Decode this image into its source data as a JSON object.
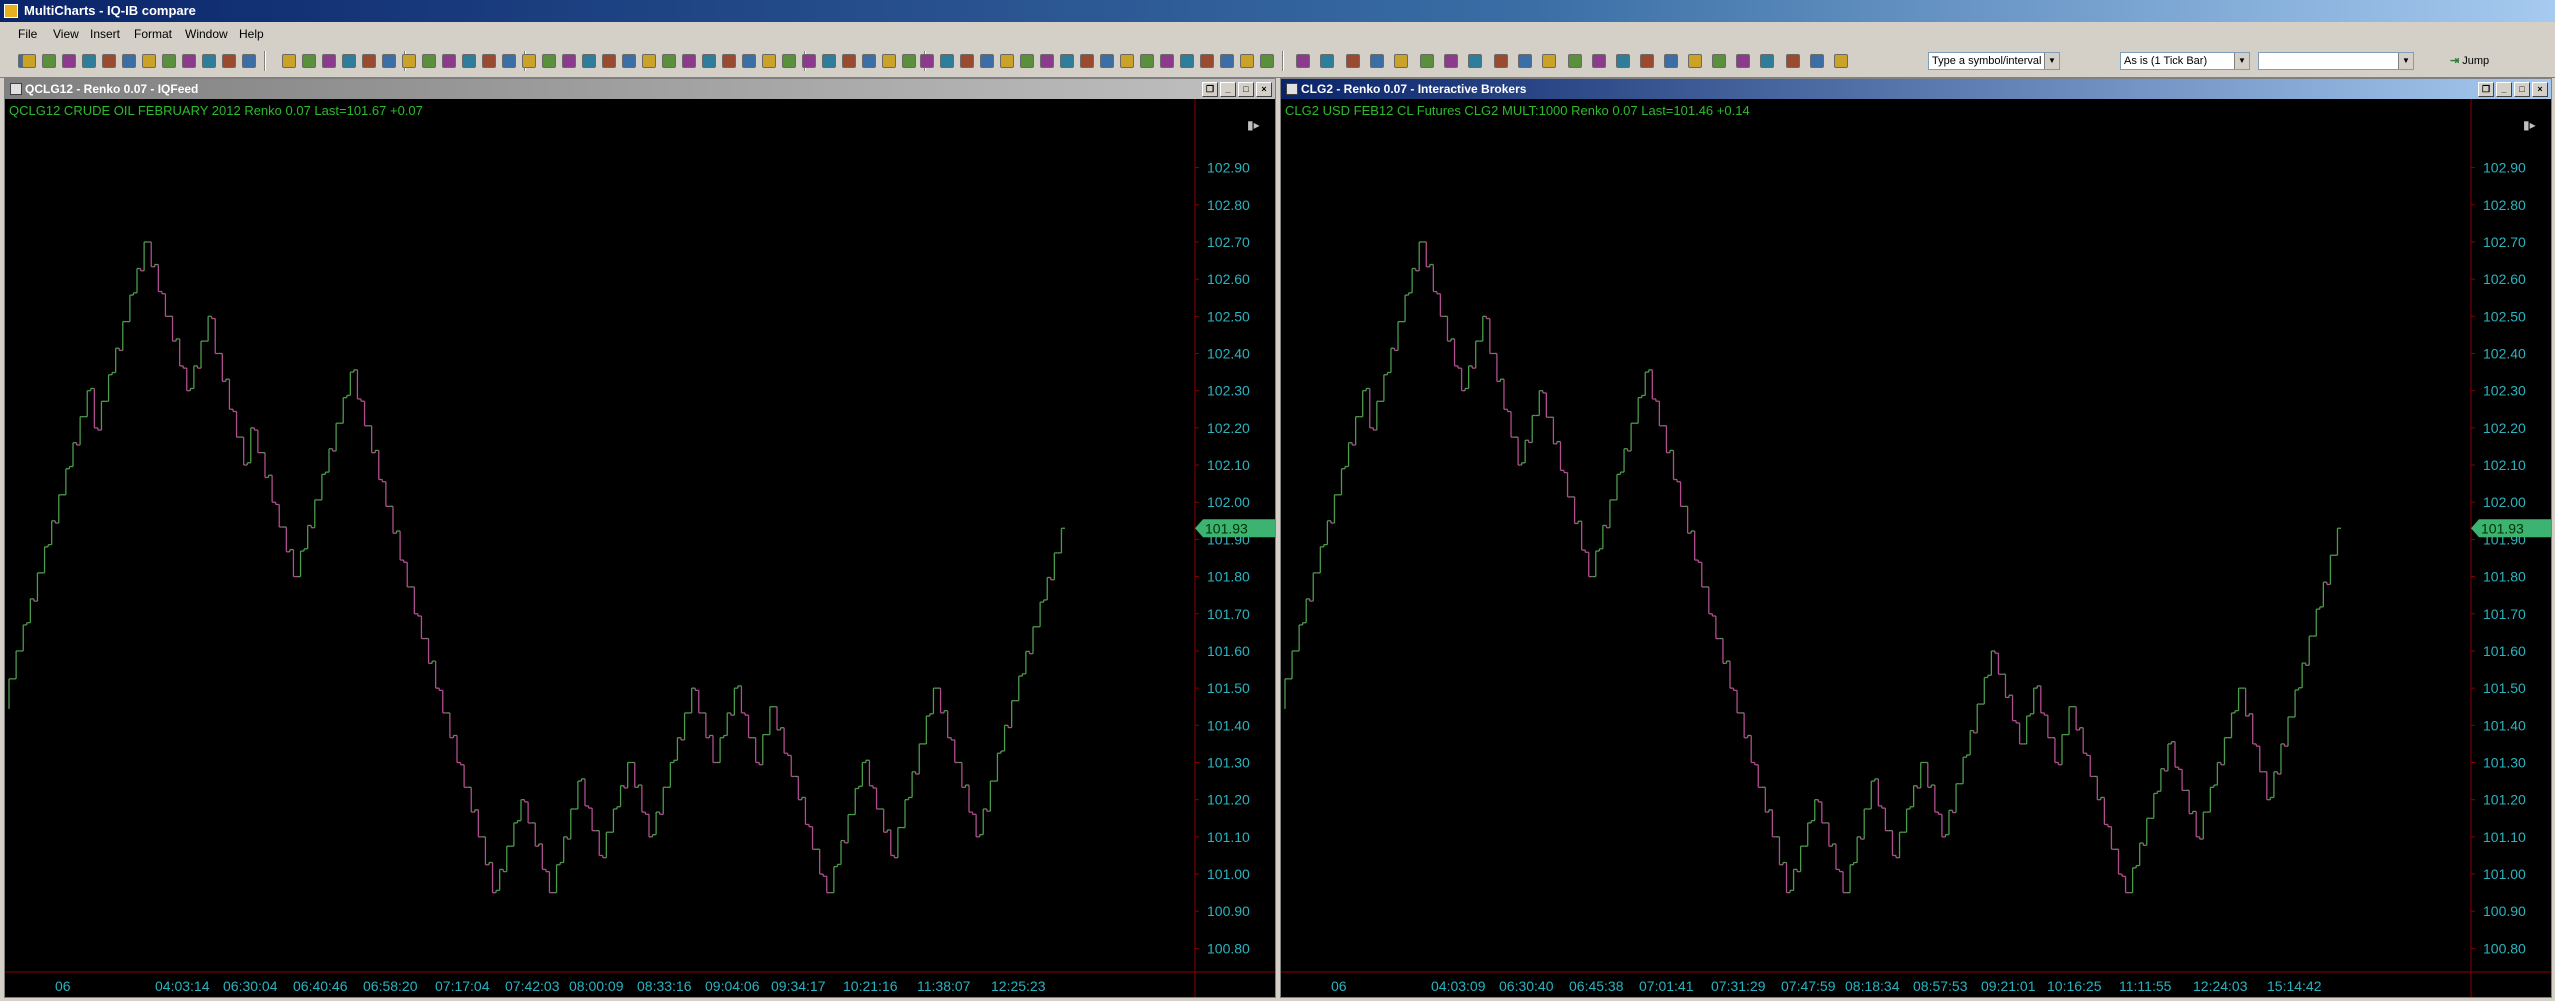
{
  "app": {
    "title": "MultiCharts - IQ-IB compare"
  },
  "menu": [
    "File",
    "View",
    "Insert",
    "Format",
    "Window",
    "Help"
  ],
  "toolbar": {
    "symbol_select": "Type a symbol/interval",
    "interval_select": "As is (1 Tick Bar)",
    "extra_select": "",
    "jump_label": "Jump"
  },
  "colors": {
    "up": "#4c9a4c",
    "down": "#b04e8e",
    "axis_text": "#2bb3c0",
    "info_text": "#2dbb2d",
    "axis_line": "#8b0000",
    "price_badge": "#3cb371"
  },
  "charts": [
    {
      "window_title": "QCLG12 - Renko 0.07 - IQFeed",
      "status": {
        "symbol": "QCLG12",
        "description": "CRUDE OIL FEBRUARY 2012",
        "renko": "Renko 0.07",
        "last": "Last=101.67",
        "change": "+0.07"
      },
      "time_labels": [
        "06",
        "04:03:14",
        "06:30:04",
        "06:40:46",
        "06:58:20",
        "07:17:04",
        "07:42:03",
        "08:00:09",
        "08:33:16",
        "09:04:06",
        "09:34:17",
        "10:21:16",
        "11:38:07",
        "12:25:23"
      ],
      "price_badge": "101.93"
    },
    {
      "window_title": "CLG2 - Renko 0.07 - Interactive Brokers",
      "status": {
        "symbol": "CLG2",
        "description": "USD FEB12 CL Futures CLG2 MULT:1000",
        "renko": "Renko 0.07",
        "last": "Last=101.46",
        "change": "+0.14"
      },
      "time_labels": [
        "06",
        "04:03:09",
        "06:30:40",
        "06:45:38",
        "07:01:41",
        "07:31:29",
        "07:47:59",
        "08:18:34",
        "08:57:53",
        "09:21:01",
        "10:16:25",
        "11:11:55",
        "12:24:03",
        "15:14:42"
      ],
      "price_badge": "101.93"
    }
  ],
  "chart_data": [
    {
      "type": "renko",
      "title": "QCLG12 CRUDE OIL FEBRUARY 2012 Renko 0.07",
      "y_ticks": [
        "102.90",
        "102.80",
        "102.70",
        "102.60",
        "102.50",
        "102.40",
        "102.30",
        "102.20",
        "102.10",
        "102.00",
        "101.90",
        "101.80",
        "101.70",
        "101.60",
        "101.50",
        "101.40",
        "101.30",
        "101.20",
        "101.10",
        "101.00",
        "100.90",
        "100.80"
      ],
      "ylim": [
        100.75,
        102.95
      ],
      "x_labels": [
        "06",
        "04:03:14",
        "06:30:04",
        "06:40:46",
        "06:58:20",
        "07:17:04",
        "07:42:03",
        "08:00:09",
        "08:33:16",
        "09:04:06",
        "09:34:17",
        "10:21:16",
        "11:38:07",
        "12:25:23"
      ],
      "last_price": 101.93,
      "price_path": [
        101.45,
        101.6,
        102.3,
        102.2,
        102.7,
        102.3,
        102.5,
        102.4,
        102.1,
        102.2,
        101.8,
        102.35,
        101.7,
        101.1,
        100.95,
        101.2,
        100.95,
        101.25,
        101.05,
        101.3,
        101.1,
        101.5,
        101.3,
        101.5,
        101.3,
        101.45,
        101.2,
        101.0,
        100.95,
        101.3,
        101.05,
        101.5,
        101.1,
        101.4,
        101.93
      ]
    },
    {
      "type": "renko",
      "title": "CLG2 USD FEB12 CL Futures CLG2 MULT:1000 Renko 0.07",
      "y_ticks": [
        "102.90",
        "102.80",
        "102.70",
        "102.60",
        "102.50",
        "102.40",
        "102.30",
        "102.20",
        "102.10",
        "102.00",
        "101.90",
        "101.80",
        "101.70",
        "101.60",
        "101.50",
        "101.40",
        "101.30",
        "101.20",
        "101.10",
        "101.00",
        "100.90",
        "100.80"
      ],
      "ylim": [
        100.75,
        102.95
      ],
      "x_labels": [
        "06",
        "04:03:09",
        "06:30:40",
        "06:45:38",
        "07:01:41",
        "07:31:29",
        "07:47:59",
        "08:18:34",
        "08:57:53",
        "09:21:01",
        "10:16:25",
        "11:11:55",
        "12:24:03",
        "15:14:42"
      ],
      "last_price": 101.93,
      "price_path": [
        101.45,
        101.6,
        102.3,
        102.2,
        102.7,
        102.3,
        102.5,
        102.4,
        102.1,
        102.3,
        101.8,
        102.35,
        101.7,
        101.1,
        100.95,
        101.2,
        100.95,
        101.25,
        101.05,
        101.3,
        101.1,
        101.6,
        101.35,
        101.5,
        101.3,
        101.45,
        101.2,
        101.0,
        100.95,
        101.35,
        101.1,
        101.5,
        101.2,
        101.35,
        101.93
      ]
    }
  ]
}
